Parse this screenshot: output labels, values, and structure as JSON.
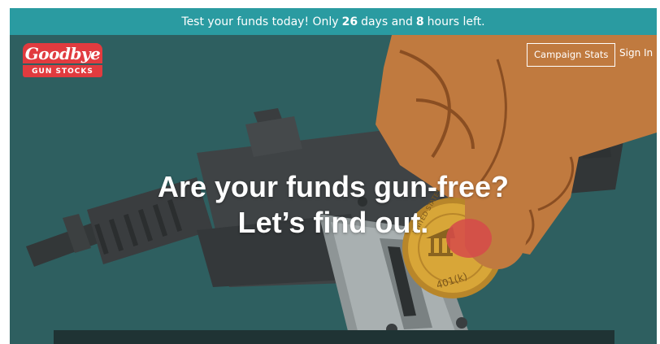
{
  "banner": {
    "prefix": "Test your funds today! Only",
    "days": "26",
    "middle": "days and",
    "hours": "8",
    "suffix": "hours left."
  },
  "logo": {
    "line1": "Goodbye",
    "line2": "GUN STOCKS"
  },
  "nav": {
    "campaign_stats": "Campaign Stats",
    "sign_in": "Sign In"
  },
  "hero": {
    "headline_line1": "Are your funds gun-free?",
    "headline_line2": "Let’s find out."
  },
  "coin": {
    "label": "401(k)",
    "arc_text": "UNITED STATES"
  },
  "colors": {
    "background": "#2d5e5f",
    "banner": "#2a9ba1",
    "logo_red": "#e13b3f",
    "hand": "#c07a3f",
    "gun": "#3b3e40",
    "coin": "#d8a638"
  }
}
